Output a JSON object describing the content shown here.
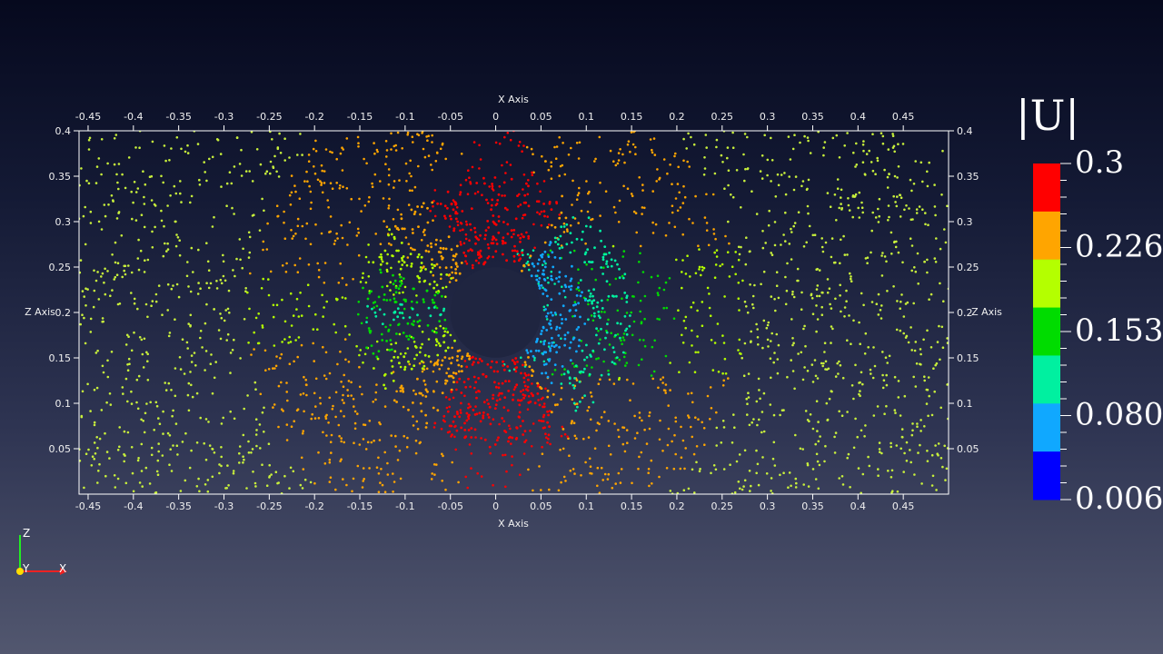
{
  "chart_data": {
    "type": "scatter",
    "title": "",
    "xlabel": "X Axis",
    "ylabel": "Z Axis",
    "xlim": [
      -0.46,
      0.5
    ],
    "ylim": [
      0.0,
      0.4
    ],
    "x_ticks": [
      "-0.45",
      "-0.4",
      "-0.35",
      "-0.3",
      "-0.25",
      "-0.2",
      "-0.15",
      "-0.1",
      "-0.05",
      "0",
      "0.05",
      "0.1",
      "0.15",
      "0.2",
      "0.25",
      "0.3",
      "0.35",
      "0.4",
      "0.45"
    ],
    "y_ticks": [
      "0.05",
      "0.1",
      "0.15",
      "0.2",
      "0.25",
      "0.3",
      "0.35",
      "0.4"
    ],
    "grid": false,
    "point_color": "#c8f03c",
    "frame_color": "#ffffff",
    "hole": {
      "center": [
        0.0,
        0.2
      ],
      "radius": 0.05
    },
    "color_field": "|U|",
    "colorbar": {
      "title": "|U|",
      "labels": [
        "0.3",
        "0.2267",
        "0.1534",
        "0.0800",
        "0.0067"
      ],
      "range": [
        0.0067,
        0.3
      ],
      "colors": [
        "#ff0000",
        "#ffa500",
        "#b4ff00",
        "#00dc00",
        "#00f0a0",
        "#10a8ff",
        "#0000ff"
      ]
    },
    "orientation_axes": [
      "Z",
      "Y",
      "X"
    ]
  }
}
